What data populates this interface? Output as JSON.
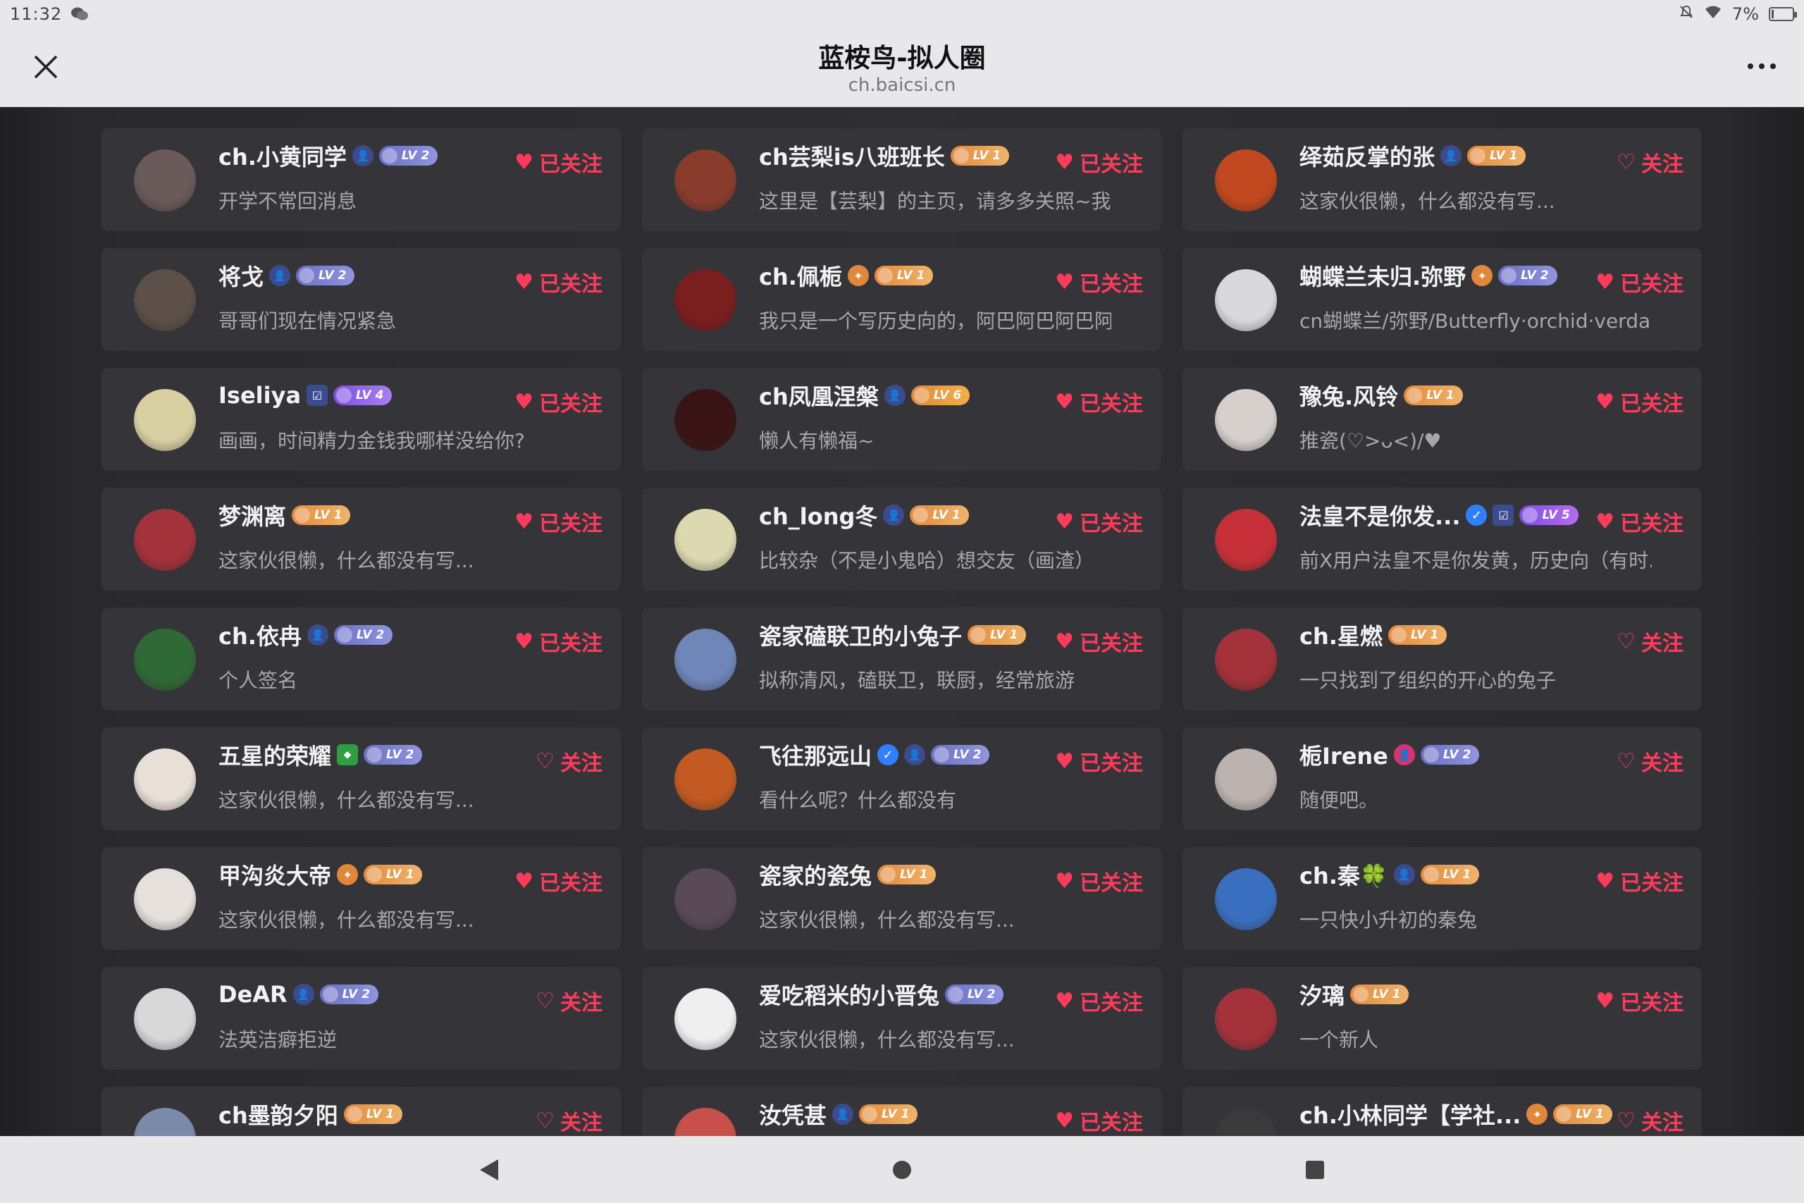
{
  "status": {
    "time": "11:32",
    "battery": "7%"
  },
  "header": {
    "title": "蓝桉鸟-拟人圈",
    "url": "ch.baicsi.cn"
  },
  "colors": {
    "followed": "#ff3b5c",
    "accent": "#ff3b5c"
  },
  "users": [
    {
      "name": "ch.小黄同学",
      "badges": [
        "person"
      ],
      "level": "LV 2",
      "lvclass": "lv2",
      "bio": "开学不常回消息",
      "follow": "已关注",
      "followed": true,
      "avatar": "#6a5a5a"
    },
    {
      "name": "ch芸梨is八班班长",
      "badges": [],
      "level": "LV 1",
      "lvclass": "lv1",
      "bio": "这里是【芸梨】的主页，请多多关照~我...",
      "follow": "已关注",
      "followed": true,
      "avatar": "#8a3c2c"
    },
    {
      "name": "绎茹反掌的张",
      "badges": [
        "person"
      ],
      "level": "LV 1",
      "lvclass": "lv1",
      "bio": "这家伙很懒，什么都没有写...",
      "follow": "关注",
      "followed": false,
      "avatar": "#c2481f"
    },
    {
      "name": "将戈",
      "badges": [
        "person"
      ],
      "level": "LV 2",
      "lvclass": "lv2",
      "bio": "哥哥们现在情况紧急",
      "follow": "已关注",
      "followed": true,
      "avatar": "#5c5048"
    },
    {
      "name": "ch.佩栀",
      "badges": [
        "medal"
      ],
      "level": "LV 1",
      "lvclass": "lv1",
      "bio": "我只是一个写历史向的，阿巴阿巴阿巴阿...",
      "follow": "已关注",
      "followed": true,
      "avatar": "#7a1e1e"
    },
    {
      "name": "蝴蝶兰未归.弥野",
      "badges": [
        "medal"
      ],
      "level": "LV 2",
      "lvclass": "lv2",
      "bio": "cn蝴蝶兰/弥野/Butterfly·orchid·verdant ...",
      "follow": "已关注",
      "followed": true,
      "avatar": "#d9d9dc"
    },
    {
      "name": "Iseliya",
      "badges": [
        "square"
      ],
      "level": "LV 4",
      "lvclass": "lv4",
      "bio": "画画，时间精力金钱我哪样没给你?",
      "follow": "已关注",
      "followed": true,
      "avatar": "#d8cfa2"
    },
    {
      "name": "ch凤凰涅槃",
      "badges": [
        "person"
      ],
      "level": "LV 6",
      "lvclass": "lv6",
      "bio": "懒人有懒福~",
      "follow": "已关注",
      "followed": true,
      "avatar": "#3a1414"
    },
    {
      "name": "豫兔.风铃",
      "badges": [],
      "level": "LV 1",
      "lvclass": "lv1",
      "bio": "推瓷(♡>ᴗ<)/♥",
      "follow": "已关注",
      "followed": true,
      "avatar": "#d6cfcb"
    },
    {
      "name": "梦渊离",
      "badges": [],
      "level": "LV 1",
      "lvclass": "lv1",
      "bio": "这家伙很懒，什么都没有写...",
      "follow": "已关注",
      "followed": true,
      "avatar": "#a3323a"
    },
    {
      "name": "ch_long冬",
      "badges": [
        "person"
      ],
      "level": "LV 1",
      "lvclass": "lv1",
      "bio": "比较杂（不是小鬼哈）想交友（画渣）",
      "follow": "已关注",
      "followed": true,
      "avatar": "#dcd8b0"
    },
    {
      "name": "法皇不是你发...",
      "badges": [
        "verify",
        "square"
      ],
      "level": "LV 5",
      "lvclass": "lv5",
      "bio": "前X用户法皇不是你发黄，历史向（有时...",
      "follow": "已关注",
      "followed": true,
      "avatar": "#c73038"
    },
    {
      "name": "ch.依冉",
      "badges": [
        "person"
      ],
      "level": "LV 2",
      "lvclass": "lv2",
      "bio": "个人签名",
      "follow": "已关注",
      "followed": true,
      "avatar": "#2f6a36"
    },
    {
      "name": "瓷家磕联卫的小兔子",
      "badges": [],
      "level": "LV 1",
      "lvclass": "lv1",
      "bio": "拟称清风，磕联卫，联厨，经常旅游",
      "follow": "已关注",
      "followed": true,
      "avatar": "#6f86b8"
    },
    {
      "name": "ch.星燃",
      "badges": [],
      "level": "LV 1",
      "lvclass": "lv1",
      "bio": "一只找到了组织的开心的兔子",
      "follow": "关注",
      "followed": false,
      "avatar": "#a3323a"
    },
    {
      "name": "五星的荣耀",
      "badges": [
        "shield"
      ],
      "level": "LV 2",
      "lvclass": "lv2",
      "bio": "这家伙很懒，什么都没有写...",
      "follow": "关注",
      "followed": false,
      "avatar": "#e8dfd6"
    },
    {
      "name": "飞往那远山",
      "badges": [
        "verify",
        "person"
      ],
      "level": "LV 2",
      "lvclass": "lv2",
      "bio": "看什么呢？什么都没有",
      "follow": "已关注",
      "followed": true,
      "avatar": "#c25a22"
    },
    {
      "name": "栀Irene",
      "badges": [
        "pink"
      ],
      "level": "LV 2",
      "lvclass": "lv2",
      "bio": "随便吧。",
      "follow": "关注",
      "followed": false,
      "avatar": "#bdb3ae"
    },
    {
      "name": "甲沟炎大帝",
      "badges": [
        "medal"
      ],
      "level": "LV 1",
      "lvclass": "lv1",
      "bio": "这家伙很懒，什么都没有写...",
      "follow": "已关注",
      "followed": true,
      "avatar": "#e6e0dc"
    },
    {
      "name": "瓷家的瓷兔",
      "badges": [],
      "level": "LV 1",
      "lvclass": "lv1",
      "bio": "这家伙很懒，什么都没有写...",
      "follow": "已关注",
      "followed": true,
      "avatar": "#5a4a55"
    },
    {
      "name": "ch.秦🍀",
      "badges": [
        "person"
      ],
      "level": "LV 1",
      "lvclass": "lv1",
      "bio": "一只快小升初的秦兔",
      "follow": "已关注",
      "followed": true,
      "avatar": "#3a6fc0"
    },
    {
      "name": "DeAR",
      "badges": [
        "person"
      ],
      "level": "LV 2",
      "lvclass": "lv2",
      "bio": "法英洁癖拒逆",
      "follow": "关注",
      "followed": false,
      "avatar": "#d8d8d8"
    },
    {
      "name": "爱吃稻米的小晋兔",
      "badges": [],
      "level": "LV 2",
      "lvclass": "lv2",
      "bio": "这家伙很懒，什么都没有写...",
      "follow": "已关注",
      "followed": true,
      "avatar": "#efefef"
    },
    {
      "name": "汐璃",
      "badges": [],
      "level": "LV 1",
      "lvclass": "lv1",
      "bio": "一个新人",
      "follow": "已关注",
      "followed": true,
      "avatar": "#a3323a"
    },
    {
      "name": "ch墨韵夕阳",
      "badges": [],
      "level": "LV 1",
      "lvclass": "lv1",
      "bio": "",
      "follow": "关注",
      "followed": false,
      "avatar": "#7a8aa8"
    },
    {
      "name": "汝凭甚",
      "badges": [
        "person"
      ],
      "level": "LV 1",
      "lvclass": "lv1",
      "bio": "",
      "follow": "已关注",
      "followed": true,
      "avatar": "#c8504a"
    },
    {
      "name": "ch.小林同学【学社...",
      "badges": [
        "medal"
      ],
      "level": "LV 1",
      "lvclass": "lv1",
      "bio": "",
      "follow": "关注",
      "followed": false,
      "avatar": "#3a3a3a"
    }
  ]
}
